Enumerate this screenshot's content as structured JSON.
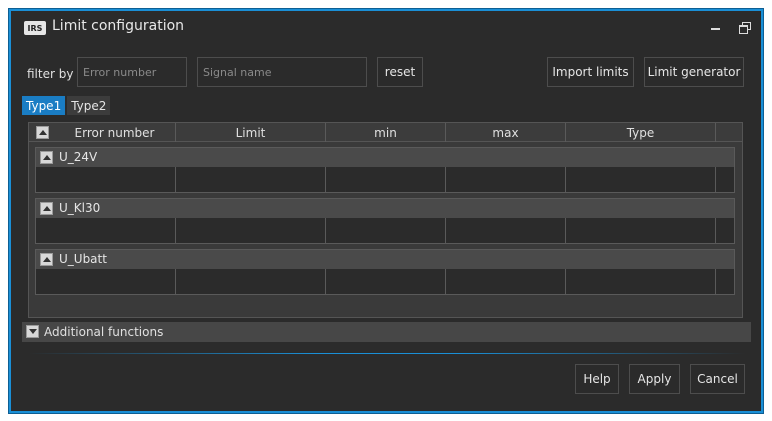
{
  "window": {
    "logo_text": "IRS",
    "title": "Limit configuration",
    "accent_color": "#1a8fd6",
    "controls": [
      "minimize-icon",
      "restore-icon"
    ]
  },
  "filter": {
    "label": "filter by",
    "error_number_placeholder": "Error number",
    "signal_name_placeholder": "Signal name",
    "reset_label": "reset"
  },
  "toolbar": {
    "import_label": "Import limits",
    "generator_label": "Limit generator"
  },
  "tabs": [
    {
      "label": "Type1",
      "active": true
    },
    {
      "label": "Type2",
      "active": false
    }
  ],
  "table": {
    "columns": [
      "Error number",
      "Limit",
      "min",
      "max",
      "Type"
    ],
    "groups": [
      {
        "name": "U_24V"
      },
      {
        "name": "U_Kl30"
      },
      {
        "name": "U_Ubatt"
      }
    ]
  },
  "additional": {
    "label": "Additional functions"
  },
  "footer": {
    "help_label": "Help",
    "apply_label": "Apply",
    "cancel_label": "Cancel"
  }
}
